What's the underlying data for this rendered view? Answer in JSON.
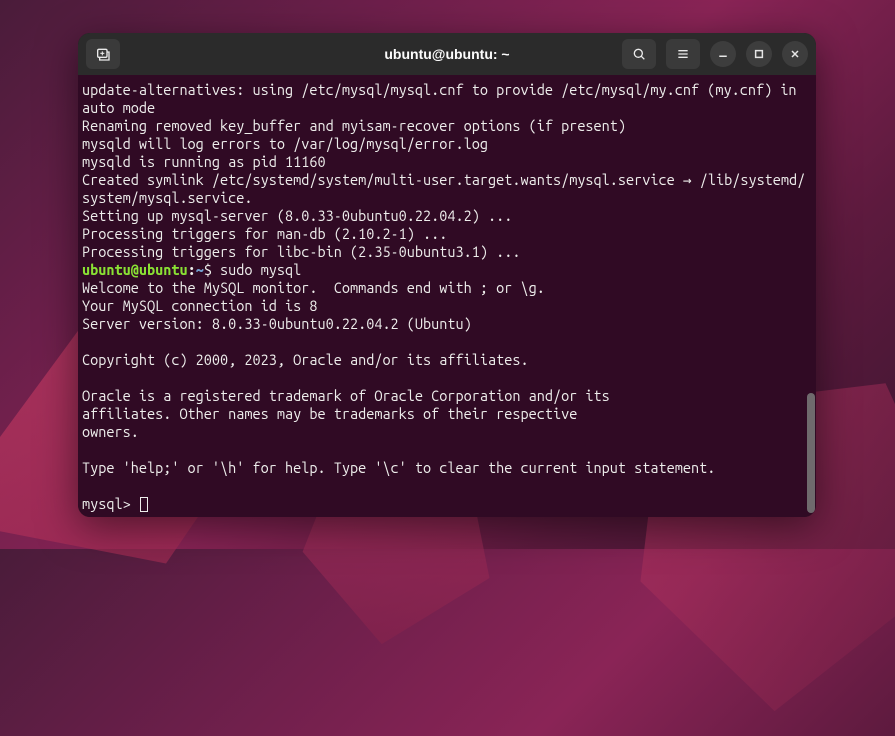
{
  "window": {
    "title": "ubuntu@ubuntu: ~"
  },
  "prompt": {
    "user_host": "ubuntu@ubuntu",
    "colon": ":",
    "cwd": "~",
    "sigil": "$",
    "command": " sudo mysql"
  },
  "mysql_prompt": "mysql> ",
  "lines": [
    "update-alternatives: using /etc/mysql/mysql.cnf to provide /etc/mysql/my.cnf (my.cnf) in auto mode",
    "Renaming removed key_buffer and myisam-recover options (if present)",
    "mysqld will log errors to /var/log/mysql/error.log",
    "mysqld is running as pid 11160",
    "Created symlink /etc/systemd/system/multi-user.target.wants/mysql.service → /lib/systemd/system/mysql.service.",
    "Setting up mysql-server (8.0.33-0ubuntu0.22.04.2) ...",
    "Processing triggers for man-db (2.10.2-1) ...",
    "Processing triggers for libc-bin (2.35-0ubuntu3.1) ..."
  ],
  "mysql_output": [
    "Welcome to the MySQL monitor.  Commands end with ; or \\g.",
    "Your MySQL connection id is 8",
    "Server version: 8.0.33-0ubuntu0.22.04.2 (Ubuntu)",
    "",
    "Copyright (c) 2000, 2023, Oracle and/or its affiliates.",
    "",
    "Oracle is a registered trademark of Oracle Corporation and/or its",
    "affiliates. Other names may be trademarks of their respective",
    "owners.",
    "",
    "Type 'help;' or '\\h' for help. Type '\\c' to clear the current input statement.",
    ""
  ]
}
